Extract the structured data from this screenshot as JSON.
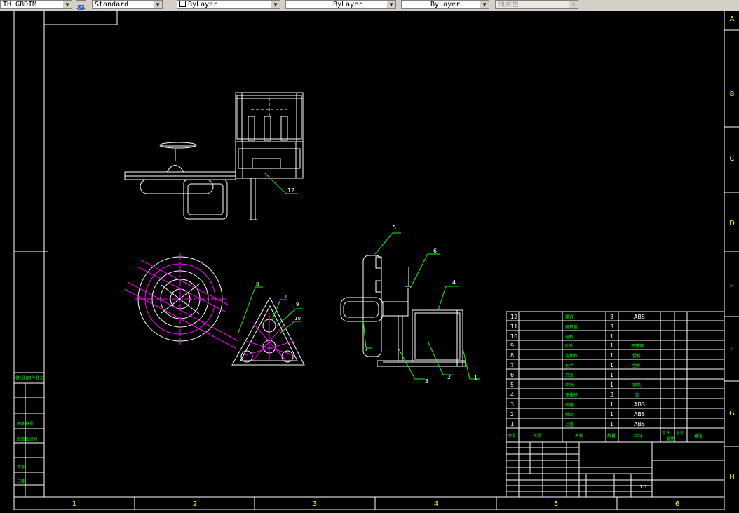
{
  "toolbar": {
    "dimstyle": "TH_GBDIM",
    "textstyle": "Standard",
    "layer_color": "ByLayer",
    "linetype": "ByLayer",
    "lineweight": "ByLayer",
    "plotstyle": "随颜色"
  },
  "border": {
    "cols": [
      "1",
      "2",
      "3",
      "4",
      "5",
      "6"
    ],
    "rows": [
      "A",
      "B",
      "C",
      "D",
      "E",
      "F",
      "G",
      "H"
    ]
  },
  "balloons": [
    "1",
    "2",
    "3",
    "4",
    "5",
    "6",
    "7",
    "8",
    "9",
    "10",
    "11",
    "12"
  ],
  "bom": {
    "rows": [
      {
        "no": "12",
        "name": "螺钉",
        "qty": "3",
        "mat": "ABS"
      },
      {
        "no": "11",
        "name": "电机盖",
        "qty": "3",
        "mat": ""
      },
      {
        "no": "10",
        "name": "电机",
        "qty": "1",
        "mat": ""
      },
      {
        "no": "9",
        "name": "叶片",
        "qty": "1",
        "mat": "不锈钢"
      },
      {
        "no": "8",
        "name": "连接杆",
        "qty": "1",
        "mat": "塑料"
      },
      {
        "no": "7",
        "name": "把手",
        "qty": "1",
        "mat": "塑料"
      },
      {
        "no": "6",
        "name": "开关",
        "qty": "1",
        "mat": ""
      },
      {
        "no": "5",
        "name": "电池",
        "qty": "1",
        "mat": "锂电"
      },
      {
        "no": "4",
        "name": "支撑杆",
        "qty": "3",
        "mat": "铝"
      },
      {
        "no": "3",
        "name": "底座",
        "qty": "1",
        "mat": "ABS"
      },
      {
        "no": "2",
        "name": "框架",
        "qty": "1",
        "mat": "ABS"
      },
      {
        "no": "1",
        "name": "上盖",
        "qty": "1",
        "mat": "ABS"
      }
    ],
    "header": [
      "序号",
      "代号",
      "名称",
      "数量",
      "材料",
      "单件",
      "总计",
      "备注"
    ],
    "weight_header": "重量"
  },
  "titleblock": {
    "scale": "1:1"
  },
  "left_strip": [
    "借(通)用件登记",
    "旧底图总号",
    "底图总号",
    "签字",
    "日期"
  ],
  "colors": {
    "white": "#ffffff",
    "green": "#00ff00",
    "yellow": "#ffff00",
    "magenta": "#ff00ff",
    "cyan": "#00ffff"
  }
}
